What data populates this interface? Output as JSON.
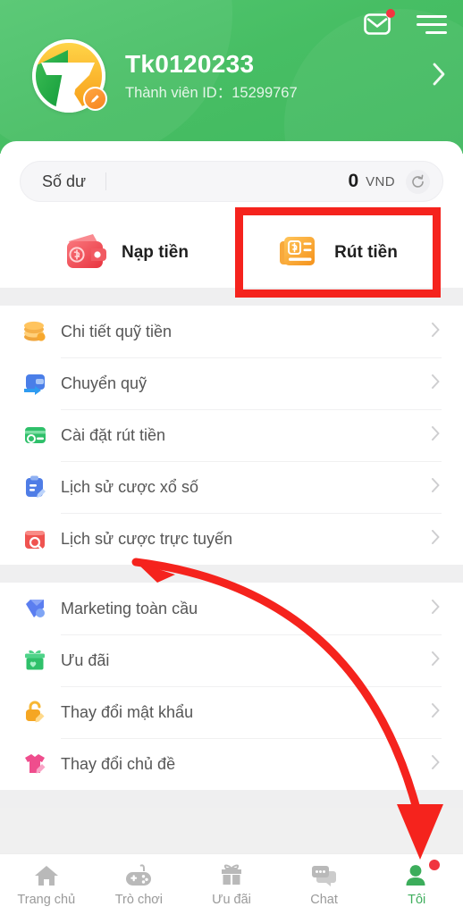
{
  "header": {
    "username": "Tk0120233",
    "member_id_label": "Thành viên ID：",
    "member_id_value": "15299767",
    "mail_icon": "mail-icon",
    "menu_icon": "hamburger-menu-icon",
    "profile_chevron_icon": "chevron-right-icon",
    "avatar_icon": "avatar-logo",
    "avatar_edit_icon": "edit-pencil-icon",
    "brand_green": "#47be64"
  },
  "balance": {
    "label": "Số dư",
    "amount": "0",
    "currency": "VND",
    "refresh_icon": "refresh-icon"
  },
  "actions": [
    {
      "label": "Nạp tiền",
      "icon": "wallet-deposit-icon",
      "color": "#ef4b52",
      "highlighted": false
    },
    {
      "label": "Rút tiền",
      "icon": "withdraw-invoice-icon",
      "color": "#f7a228",
      "highlighted": true
    }
  ],
  "menu_sections": [
    {
      "items": [
        {
          "label": "Chi tiết quỹ tiền",
          "icon": "coins-icon",
          "color": "#f2a43a"
        },
        {
          "label": "Chuyển quỹ",
          "icon": "wallet-transfer-icon",
          "color": "#4a7ee8"
        },
        {
          "label": "Cài đặt rút tiền",
          "icon": "bank-card-icon",
          "color": "#2fc06a"
        },
        {
          "label": "Lịch sử cược xổ số",
          "icon": "lottery-clipboard-icon",
          "color": "#4f7de6"
        },
        {
          "label": "Lịch sử cược trực tuyến",
          "icon": "online-history-icon",
          "color": "#ef5350"
        }
      ]
    },
    {
      "items": [
        {
          "label": "Marketing toàn cầu",
          "icon": "diamond-icon",
          "color": "#5b7ef0"
        },
        {
          "label": "Ưu đãi",
          "icon": "gift-icon",
          "color": "#33c06c"
        },
        {
          "label": "Thay đổi mật khẩu",
          "icon": "lock-icon",
          "color": "#f5a623"
        },
        {
          "label": "Thay đổi chủ đề",
          "icon": "theme-shirt-icon",
          "color": "#ef4d8d"
        }
      ]
    }
  ],
  "chevron_icon": "chevron-right-icon",
  "bottom_nav": [
    {
      "label": "Trang chủ",
      "icon": "home-icon",
      "active": false,
      "badge": false
    },
    {
      "label": "Trò chơi",
      "icon": "gamepad-icon",
      "active": false,
      "badge": false
    },
    {
      "label": "Ưu đãi",
      "icon": "gift-icon",
      "active": false,
      "badge": false
    },
    {
      "label": "Chat",
      "icon": "chat-bubble-icon",
      "active": false,
      "badge": false
    },
    {
      "label": "Tôi",
      "icon": "person-icon",
      "active": true,
      "badge": true
    }
  ],
  "annotations": {
    "highlight_color": "#f5231d",
    "box_target": "Rút tiền",
    "arrow_target": "Tôi"
  }
}
